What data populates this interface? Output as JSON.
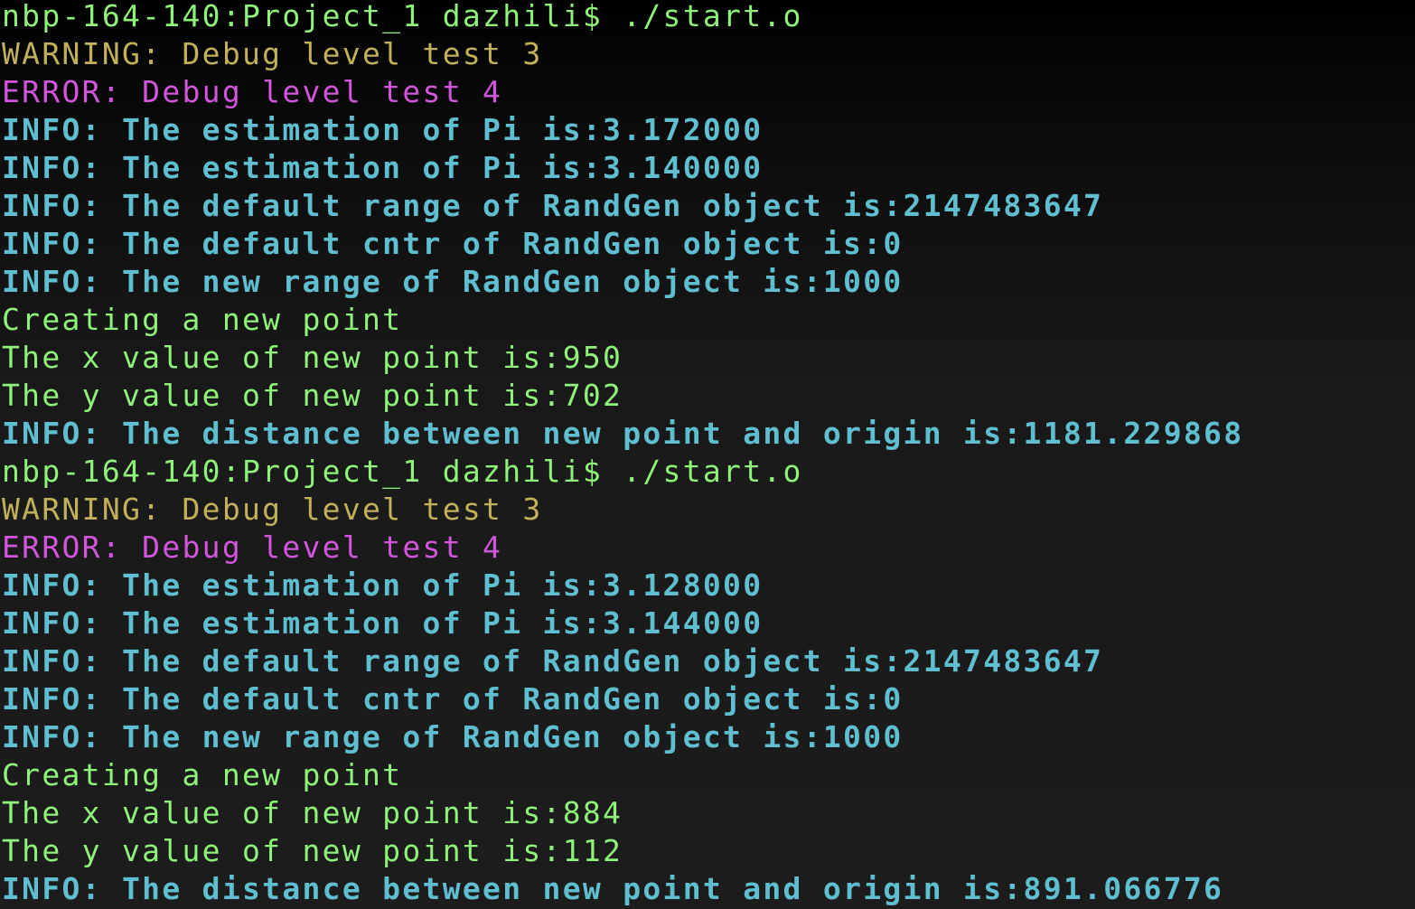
{
  "terminal": {
    "lines": [
      {
        "type": "prompt",
        "text": "nbp-164-140:Project_1 dazhili$ ./start.o"
      },
      {
        "type": "warning",
        "text": "WARNING: Debug level test 3"
      },
      {
        "type": "error",
        "text": "ERROR: Debug level test 4"
      },
      {
        "type": "info",
        "text": "INFO: The estimation of Pi is:3.172000"
      },
      {
        "type": "info",
        "text": "INFO: The estimation of Pi is:3.140000"
      },
      {
        "type": "info",
        "text": "INFO: The default range of RandGen object is:2147483647"
      },
      {
        "type": "info",
        "text": "INFO: The default cntr of RandGen object is:0"
      },
      {
        "type": "info",
        "text": "INFO: The new range of RandGen object is:1000"
      },
      {
        "type": "plain",
        "text": "Creating a new point"
      },
      {
        "type": "plain",
        "text": "The x value of new point is:950"
      },
      {
        "type": "plain",
        "text": "The y value of new point is:702"
      },
      {
        "type": "info",
        "text": "INFO: The distance between new point and origin is:1181.229868"
      },
      {
        "type": "prompt",
        "text": "nbp-164-140:Project_1 dazhili$ ./start.o"
      },
      {
        "type": "warning",
        "text": "WARNING: Debug level test 3"
      },
      {
        "type": "error",
        "text": "ERROR: Debug level test 4"
      },
      {
        "type": "info",
        "text": "INFO: The estimation of Pi is:3.128000"
      },
      {
        "type": "info",
        "text": "INFO: The estimation of Pi is:3.144000"
      },
      {
        "type": "info",
        "text": "INFO: The default range of RandGen object is:2147483647"
      },
      {
        "type": "info",
        "text": "INFO: The default cntr of RandGen object is:0"
      },
      {
        "type": "info",
        "text": "INFO: The new range of RandGen object is:1000"
      },
      {
        "type": "plain",
        "text": "Creating a new point"
      },
      {
        "type": "plain",
        "text": "The x value of new point is:884"
      },
      {
        "type": "plain",
        "text": "The y value of new point is:112"
      },
      {
        "type": "info",
        "text": "INFO: The distance between new point and origin is:891.066776"
      }
    ]
  },
  "colors": {
    "prompt": "#8ff27a",
    "warning": "#c2b05a",
    "error": "#d156dc",
    "info": "#5fbfd0",
    "background": "#1c1c1c"
  }
}
